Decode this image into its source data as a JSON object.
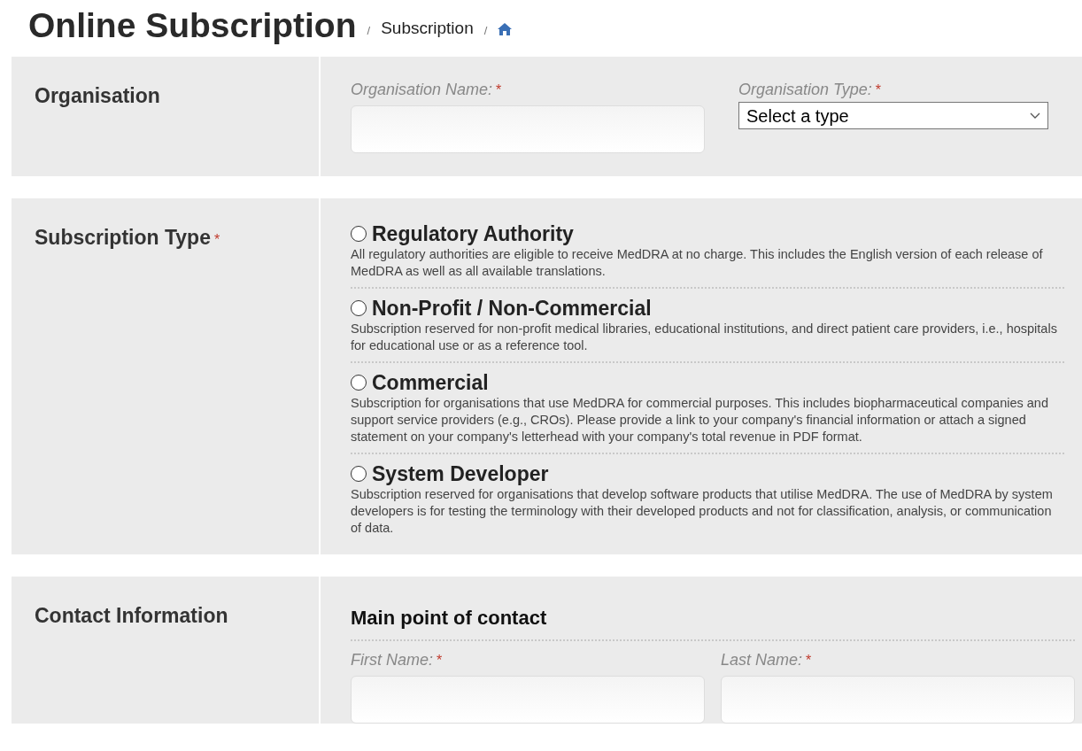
{
  "page_title": "Online Subscription",
  "breadcrumb": [
    {
      "kind": "separator",
      "text": "/"
    },
    {
      "kind": "link",
      "text": "Subscription"
    },
    {
      "kind": "separator",
      "text": "/"
    },
    {
      "kind": "home"
    }
  ],
  "sections": [
    {
      "kind": "organisation",
      "label": "Organisation",
      "fields": [
        {
          "kind": "text",
          "label": "Organisation Name:",
          "required_mark": "*"
        },
        {
          "kind": "select",
          "label": "Organisation Type:",
          "required_mark": "*",
          "value": "Select a type"
        }
      ]
    },
    {
      "kind": "subscription",
      "label": "Subscription Type",
      "required_mark": "*",
      "options": [
        {
          "title": "Regulatory Authority",
          "selected": false,
          "description": "All regulatory authorities are eligible to receive MedDRA at no charge. This includes the English version of each release of MedDRA as well as all available translations."
        },
        {
          "title": "Non-Profit / Non-Commercial",
          "selected": false,
          "description": "Subscription reserved for non-profit medical libraries, educational institutions, and direct patient care providers, i.e., hospitals for educational use or as a reference tool."
        },
        {
          "title": "Commercial",
          "selected": false,
          "description": "Subscription for organisations that use MedDRA for commercial purposes. This includes biopharmaceutical companies and support service providers (e.g., CROs). Please provide a link to your company's financial information or attach a signed statement on your company's letterhead with your company's total revenue in PDF format."
        },
        {
          "title": "System Developer",
          "selected": false,
          "description": "Subscription reserved for organisations that develop software products that utilise MedDRA. The use of MedDRA by system developers is for testing the terminology with their developed products and not for classification, analysis, or communication of data."
        }
      ]
    },
    {
      "kind": "contact",
      "label": "Contact Information",
      "subheading": "Main point of contact",
      "fields": [
        {
          "kind": "text",
          "label": "First Name:",
          "required_mark": "*"
        },
        {
          "kind": "text",
          "label": "Last Name:",
          "required_mark": "*"
        }
      ]
    }
  ]
}
